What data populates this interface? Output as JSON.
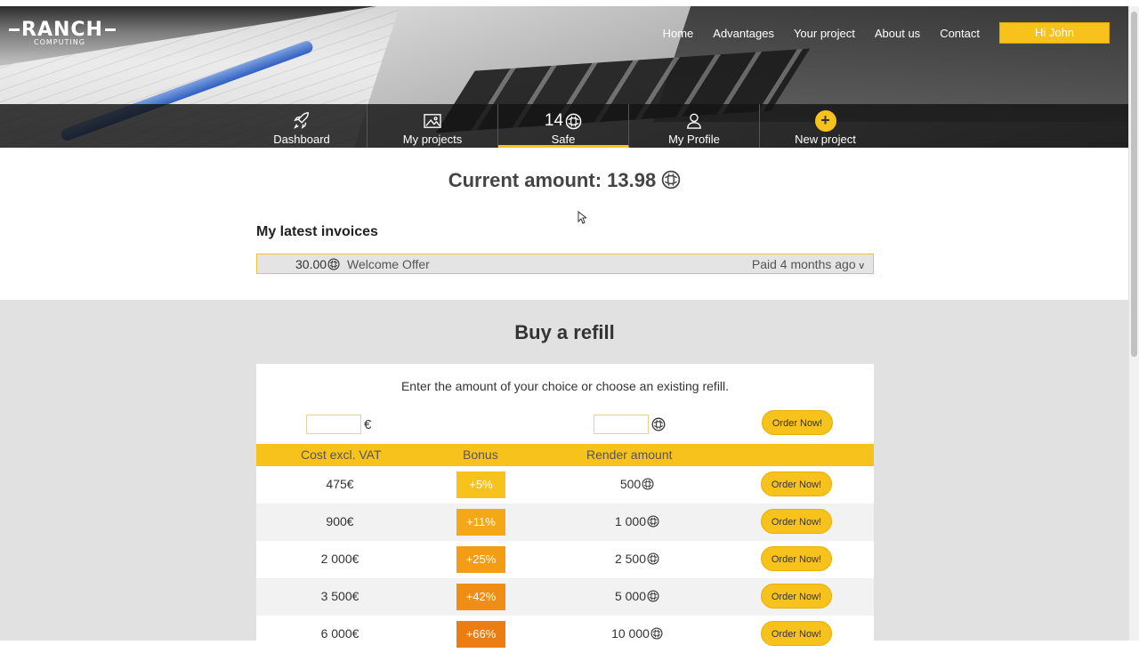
{
  "header": {
    "logo_main": "RANCH",
    "logo_sub": "COMPUTING",
    "nav": [
      "Home",
      "Advantages",
      "Your project",
      "About us",
      "Contact"
    ],
    "user_greeting": "Hi John"
  },
  "subnav": {
    "dashboard": "Dashboard",
    "projects": "My projects",
    "safe_count": "14",
    "safe": "Safe",
    "profile": "My Profile",
    "new_project": "New project"
  },
  "balance": {
    "label": "Current amount: 13.98"
  },
  "invoices": {
    "title": "My latest invoices",
    "items": [
      {
        "amount": "30.00",
        "name": "Welcome Offer",
        "status": "Paid 4 months ago",
        "toggle": "v"
      }
    ]
  },
  "refill": {
    "title": "Buy a refill",
    "intro": "Enter the amount of your choice or choose an existing refill.",
    "euro_symbol": "€",
    "order_label": "Order Now!",
    "columns": [
      "Cost excl. VAT",
      "Bonus",
      "Render amount"
    ],
    "rows": [
      {
        "cost": "475€",
        "bonus": "+5%",
        "render": "500",
        "color": "#f8c21c"
      },
      {
        "cost": "900€",
        "bonus": "+11%",
        "render": "1 000",
        "color": "#f5a817"
      },
      {
        "cost": "2 000€",
        "bonus": "+25%",
        "render": "2 500",
        "color": "#f39c16"
      },
      {
        "cost": "3 500€",
        "bonus": "+42%",
        "render": "5 000",
        "color": "#f08d15"
      },
      {
        "cost": "6 000€",
        "bonus": "+66%",
        "render": "10 000",
        "color": "#ec7d13"
      }
    ]
  },
  "colors": {
    "accent": "#f8c21c",
    "dark_bar": "#141414",
    "gray_section": "#e1e1e1"
  }
}
